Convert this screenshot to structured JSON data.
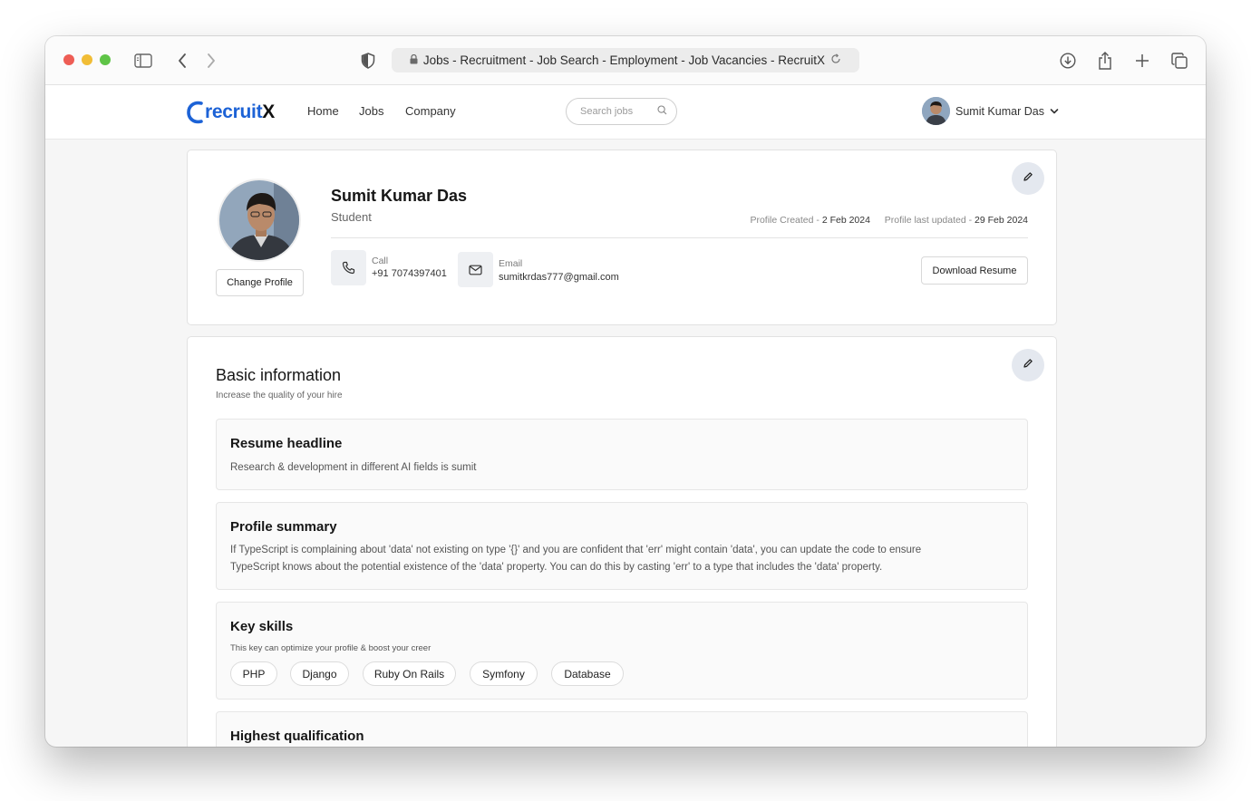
{
  "browser": {
    "url_title": "Jobs - Recruitment - Job Search -  Employment - Job Vacancies - RecruitX"
  },
  "brand": {
    "logo_main": "recruit",
    "logo_x": "X",
    "accent": "#1c62d6"
  },
  "nav": {
    "links": [
      "Home",
      "Jobs",
      "Company"
    ],
    "search_placeholder": "Search jobs",
    "user_name": "Sumit Kumar Das"
  },
  "profile": {
    "name": "Sumit Kumar Das",
    "role": "Student",
    "created_label": "Profile Created - ",
    "created_value": "2 Feb 2024",
    "updated_label": "Profile last updated - ",
    "updated_value": "29 Feb 2024",
    "change_profile": "Change Profile",
    "call_label": "Call",
    "phone": "+91 7074397401",
    "email_label": "Email",
    "email": "sumitkrdas777@gmail.com",
    "download_resume": "Download Resume"
  },
  "basic": {
    "title": "Basic information",
    "subtitle": "Increase the quality of your hire",
    "resume_headline_title": "Resume headline",
    "resume_headline_text": "Research & development in different AI fields is sumit",
    "profile_summary_title": "Profile summary",
    "profile_summary_line1": "If TypeScript is complaining about 'data' not existing on type '{}' and you are confident that 'err' might contain 'data', you can update the code to ensure",
    "profile_summary_line2": "TypeScript knows about the potential existence of the 'data' property. You can do this by casting 'err' to a type that includes the 'data' property.",
    "key_skills_title": "Key skills",
    "key_skills_subtitle": "This key can optimize your profile & boost your creer",
    "skills": [
      "PHP",
      "Django",
      "Ruby On Rails",
      "Symfony",
      "Database"
    ],
    "qualification_title": "Highest qualification"
  }
}
